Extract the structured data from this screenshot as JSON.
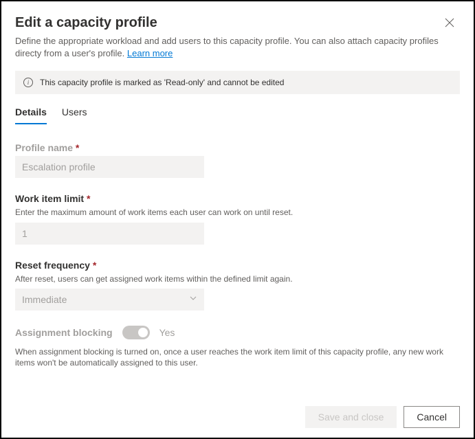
{
  "header": {
    "title": "Edit a capacity profile",
    "subtitle_part1": "Define the appropriate workload and add users to this capacity profile. You can also attach capacity profiles directy from a user's profile. ",
    "learn_more": "Learn more"
  },
  "banner": {
    "text": "This capacity profile is marked as 'Read-only' and cannot be edited"
  },
  "tabs": {
    "details": "Details",
    "users": "Users"
  },
  "fields": {
    "profile_name": {
      "label": "Profile name",
      "value": "Escalation profile"
    },
    "work_item_limit": {
      "label": "Work item limit",
      "hint": "Enter the maximum amount of work items each user can work on until reset.",
      "value": "1"
    },
    "reset_frequency": {
      "label": "Reset frequency",
      "hint": "After reset, users can get assigned work items within the defined limit again.",
      "value": "Immediate"
    },
    "assignment_blocking": {
      "label": "Assignment blocking",
      "state": "Yes",
      "hint": "When assignment blocking is turned on, once a user reaches the work item limit of this capacity profile, any new work items won't be automatically assigned to this user."
    }
  },
  "footer": {
    "save": "Save and close",
    "cancel": "Cancel"
  }
}
